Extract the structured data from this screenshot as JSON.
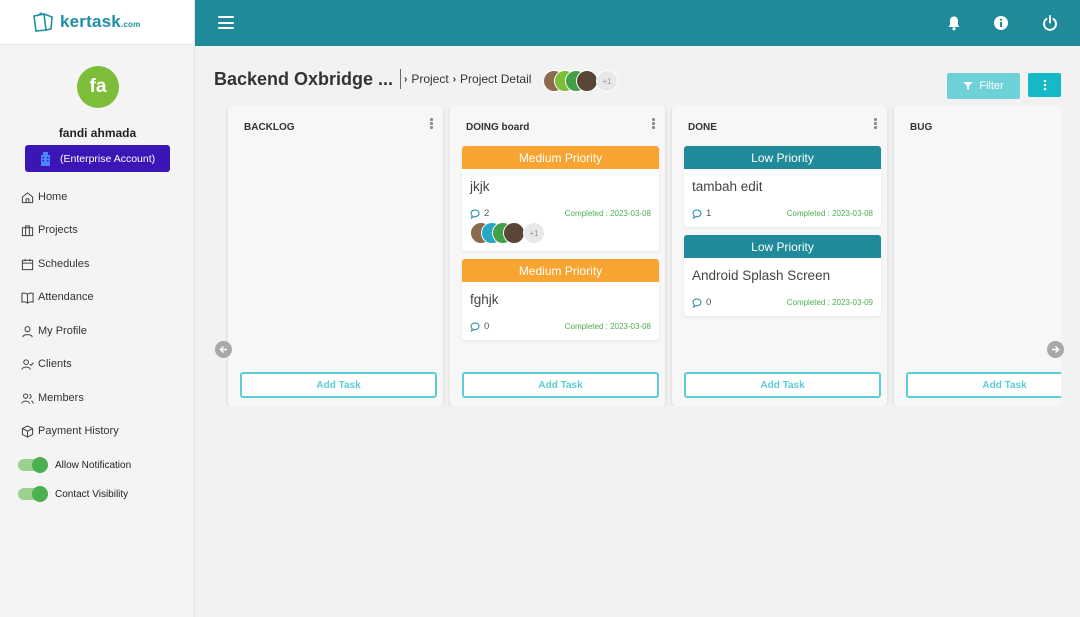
{
  "app": {
    "logo_text": "kertask",
    "logo_suffix": ".com"
  },
  "user": {
    "initials": "fa",
    "name": "fandi ahmada",
    "account_type": "(Enterprise Account)"
  },
  "sidebar": {
    "items": [
      {
        "label": "Home",
        "icon": "home-icon"
      },
      {
        "label": "Projects",
        "icon": "briefcase-icon"
      },
      {
        "label": "Schedules",
        "icon": "calendar-icon"
      },
      {
        "label": "Attendance",
        "icon": "book-icon"
      },
      {
        "label": "My Profile",
        "icon": "user-icon"
      },
      {
        "label": "Clients",
        "icon": "user-check-icon"
      },
      {
        "label": "Members",
        "icon": "users-icon"
      },
      {
        "label": "Payment History",
        "icon": "box-icon"
      }
    ],
    "toggles": [
      {
        "label": "Allow Notification",
        "on": true
      },
      {
        "label": "Contact Visibility",
        "on": true
      }
    ]
  },
  "topbar": {
    "icons": [
      "menu-icon",
      "bell-icon",
      "info-icon",
      "power-icon"
    ]
  },
  "header": {
    "project_title": "Backend Oxbridge ...",
    "breadcrumb": [
      "Project",
      "Project Detail"
    ],
    "members_extra": "+1",
    "filter_label": "Filter"
  },
  "board": {
    "columns": [
      {
        "title": "BACKLOG",
        "add_label": "Add Task",
        "cards": []
      },
      {
        "title": "DOING board",
        "add_label": "Add Task",
        "cards": [
          {
            "priority": "Medium Priority",
            "title": "jkjk",
            "comments": "2",
            "completed": "Completed : 2023-03-08",
            "assignees_extra": "+1"
          },
          {
            "priority": "Medium Priority",
            "title": "fghjk",
            "comments": "0",
            "completed": "Completed : 2023-03-08"
          }
        ]
      },
      {
        "title": "DONE",
        "add_label": "Add Task",
        "cards": [
          {
            "priority": "Low Priority",
            "title": "tambah edit",
            "comments": "1",
            "completed": "Completed : 2023-03-08"
          },
          {
            "priority": "Low Priority",
            "title": "Android Splash Screen",
            "comments": "0",
            "completed": "Completed : 2023-03-09"
          }
        ]
      },
      {
        "title": "BUG",
        "add_label": "Add Task",
        "cards": []
      }
    ]
  },
  "colors": {
    "primary": "#1f8a99",
    "medium_priority": "#f7a530",
    "low_priority": "#1f8a99",
    "completed_text": "#4caf50",
    "account_badge": "#3b15b5"
  }
}
